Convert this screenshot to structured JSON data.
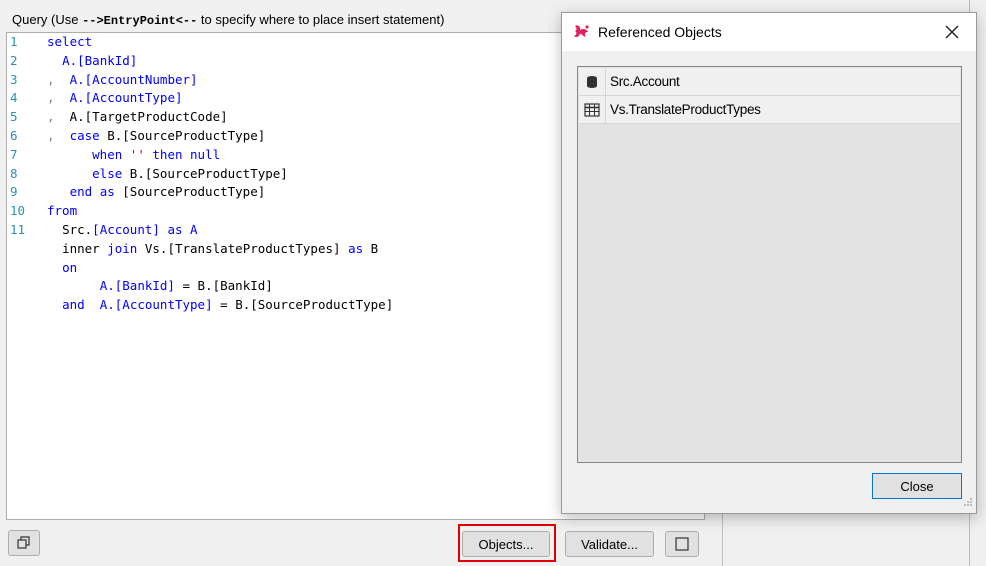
{
  "query_panel": {
    "label_prefix": "Query (Use ",
    "label_keyword": "-->EntryPoint<--",
    "label_suffix": " to specify where to place insert statement)"
  },
  "editor": {
    "line_numbers": [
      "1",
      "2",
      "3",
      "4",
      "5",
      "6",
      "7",
      "8",
      "9",
      "10",
      "11"
    ],
    "code": {
      "l1_select": "select",
      "l2_a": "A.",
      "l2_col": "[BankId]",
      "l3_comma": ",",
      "l3_a": "A.",
      "l3_col": "[AccountNumber]",
      "l4_comma": ",",
      "l4_a": "A.",
      "l4_col": "[AccountType]",
      "l5_comma": ",",
      "l5_a": "A.",
      "l5_col": "[TargetProductCode]",
      "l6_comma": ",",
      "l6_case": "case",
      "l6_rest": " B.[SourceProductType]",
      "l7_when": "when",
      "l7_str": "''",
      "l7_then": "then",
      "l7_null": "null",
      "l8_else": "else",
      "l8_rest": " B.[SourceProductType]",
      "l9_end": "end",
      "l9_as": "as",
      "l9_rest": " [SourceProductType]",
      "l10_from": "from",
      "l11_src": "Src.",
      "l11_col": "[Account]",
      "l11_as": "as",
      "l11_alias": "A",
      "l12_inner": "inner",
      "l12_join": "join",
      "l12_rest": " Vs.[TranslateProductTypes]",
      "l12_as": "as",
      "l12_alias": "B",
      "l13_on": "on",
      "l14_a": "A.",
      "l14_col": "[BankId]",
      "l14_eq": " = ",
      "l14_rest": "B.[BankId]",
      "l15_and": "and",
      "l15_a": "A.",
      "l15_col": "[AccountType]",
      "l15_eq": " = ",
      "l15_rest": "B.[SourceProductType]"
    }
  },
  "buttons": {
    "objects": "Objects...",
    "validate": "Validate..."
  },
  "dialog": {
    "title": "Referenced Objects",
    "close_button": "Close",
    "items": [
      {
        "name": "Src.Account",
        "icon": "database-icon"
      },
      {
        "name": "Vs.TranslateProductTypes",
        "icon": "table-icon"
      }
    ]
  },
  "colors": {
    "keyword": "#0000ff",
    "line_number": "#2b91af",
    "string": "#a31515",
    "highlight_box": "#e00000",
    "focus_border": "#0078d7"
  }
}
